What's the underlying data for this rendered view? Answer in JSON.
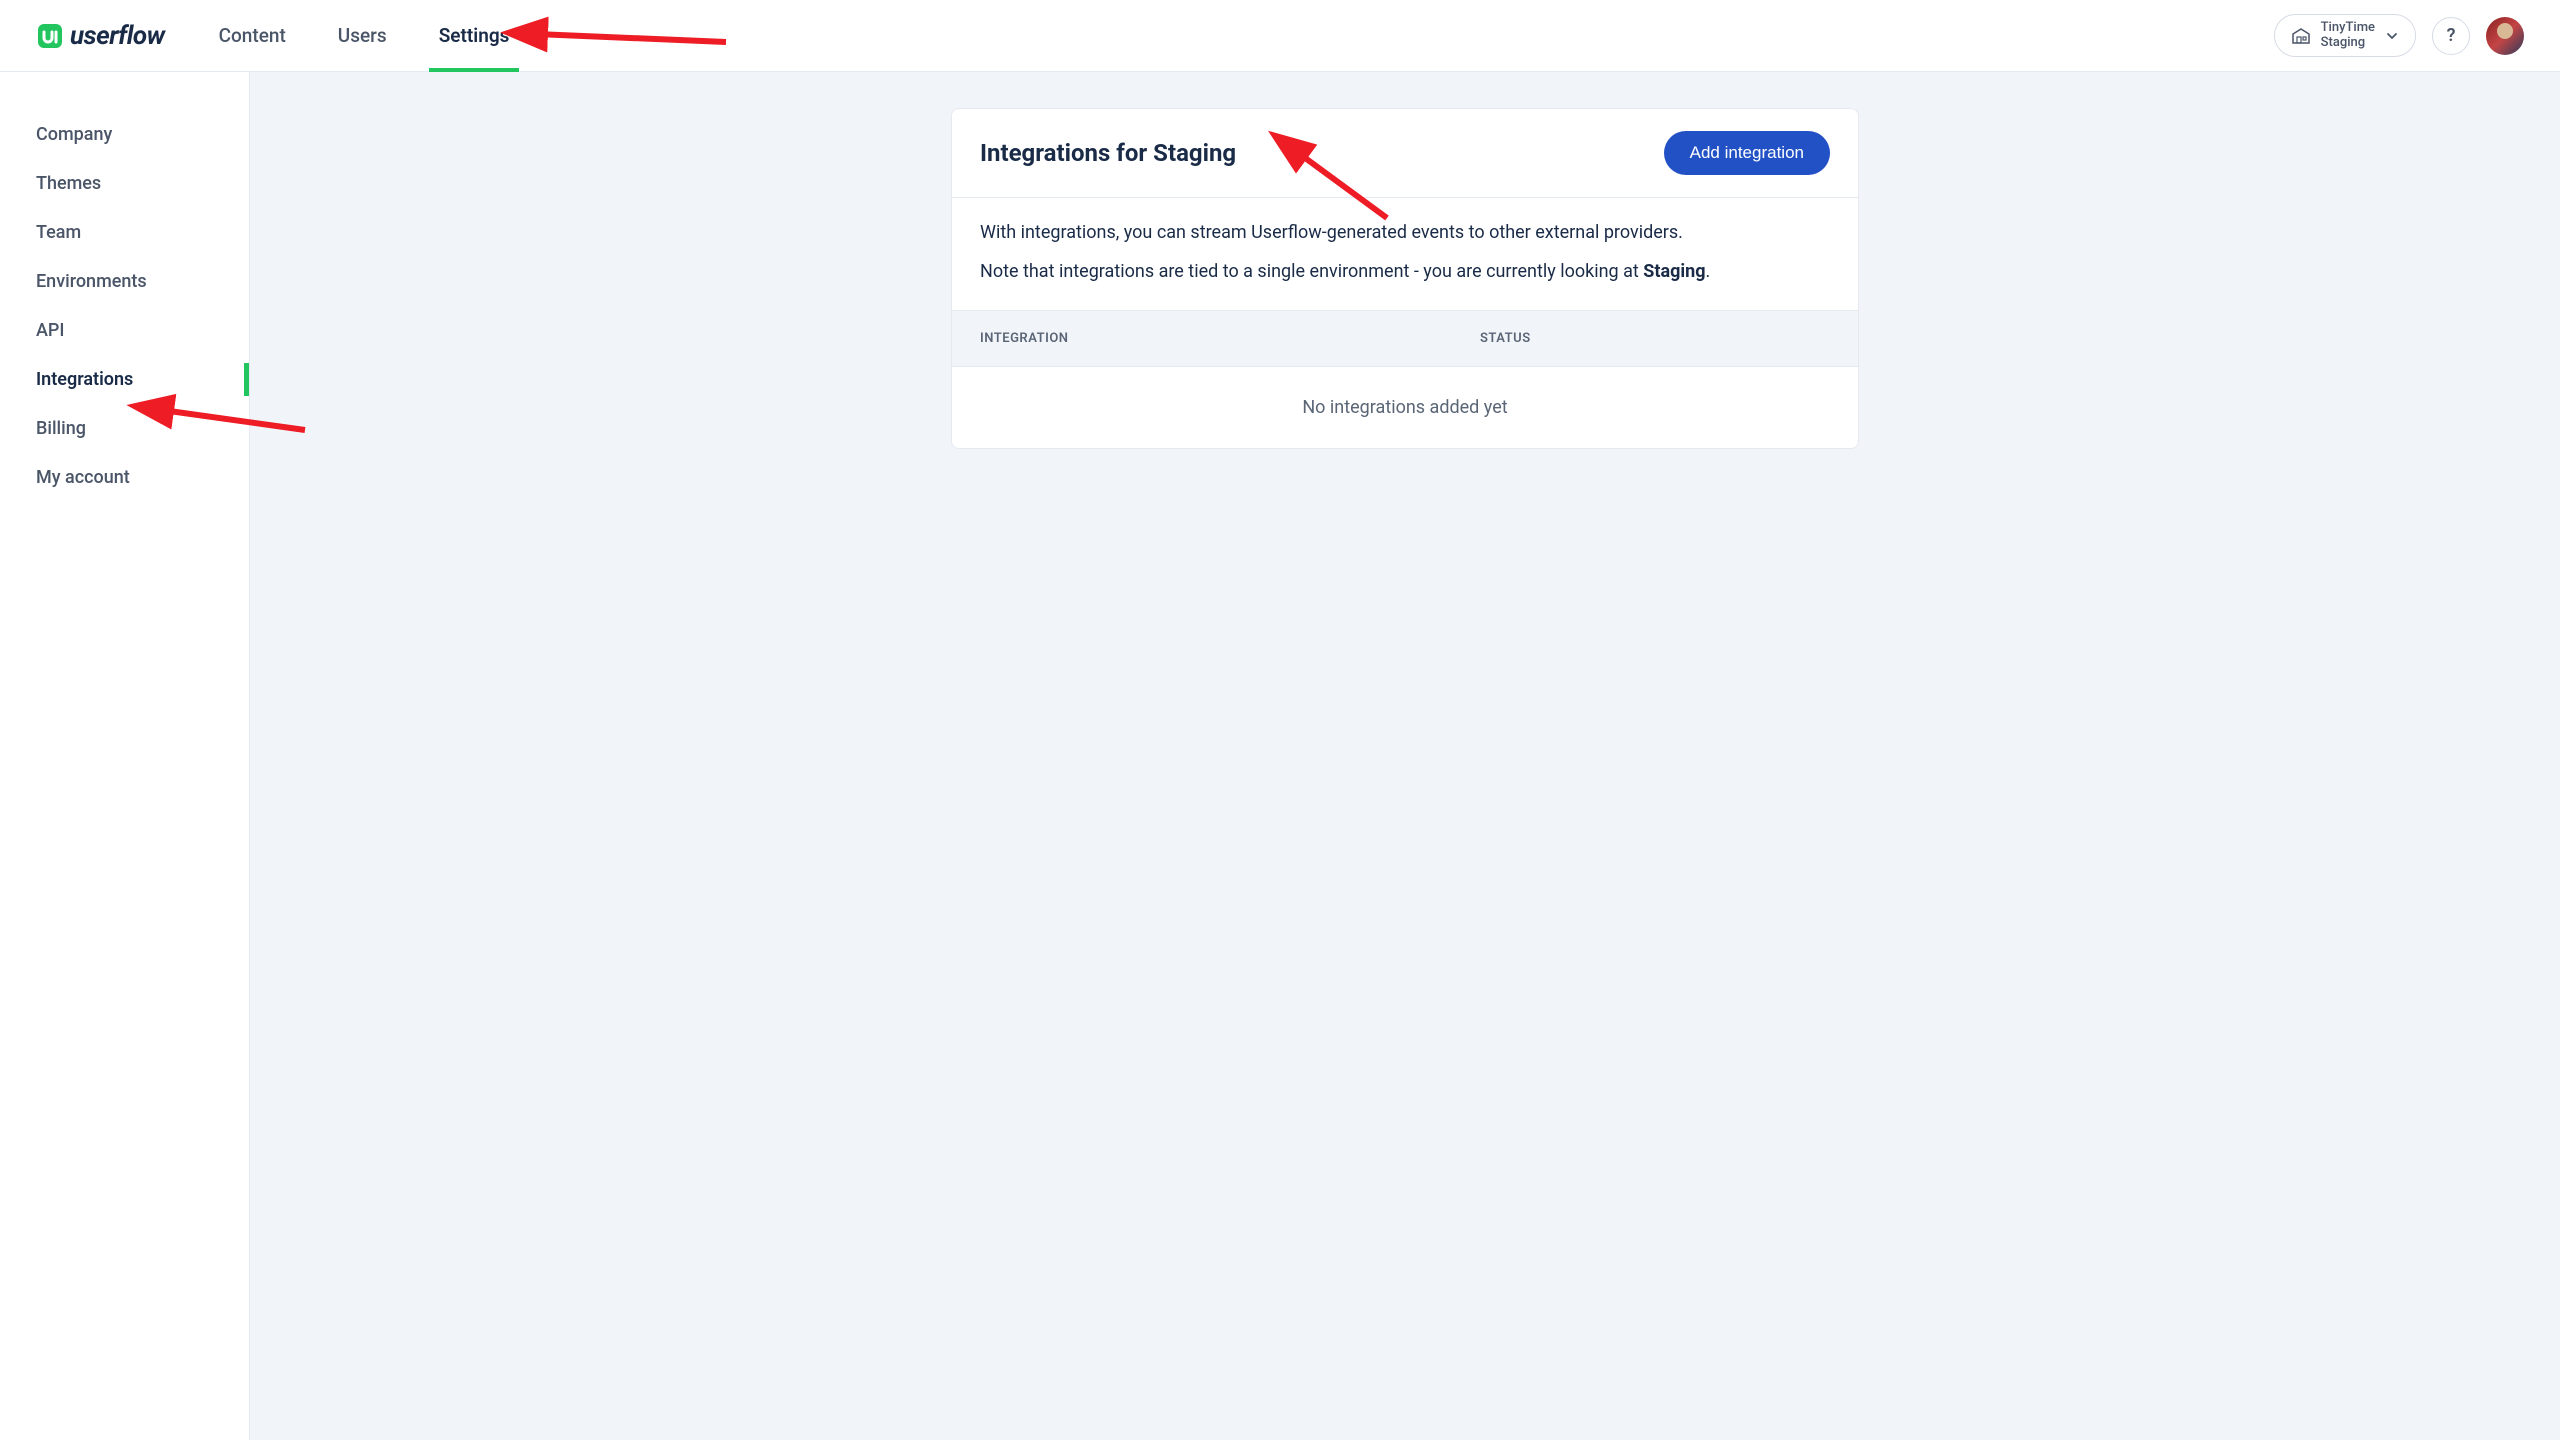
{
  "logo": {
    "text": "userflow"
  },
  "topnav": {
    "items": [
      {
        "label": "Content"
      },
      {
        "label": "Users"
      },
      {
        "label": "Settings"
      }
    ]
  },
  "env": {
    "line1": "TinyTime",
    "line2": "Staging"
  },
  "help": {
    "label": "?"
  },
  "sidebar": {
    "items": [
      {
        "label": "Company"
      },
      {
        "label": "Themes"
      },
      {
        "label": "Team"
      },
      {
        "label": "Environments"
      },
      {
        "label": "API"
      },
      {
        "label": "Integrations"
      },
      {
        "label": "Billing"
      },
      {
        "label": "My account"
      }
    ]
  },
  "card": {
    "title": "Integrations for Staging",
    "add_button": "Add integration",
    "desc1": "With integrations, you can stream Userflow-generated events to other external providers.",
    "desc2_pre": "Note that integrations are tied to a single environment - you are currently looking at ",
    "desc2_env": "Staging",
    "desc2_post": "."
  },
  "table": {
    "col_integration": "INTEGRATION",
    "col_status": "STATUS",
    "empty": "No integrations added yet"
  }
}
